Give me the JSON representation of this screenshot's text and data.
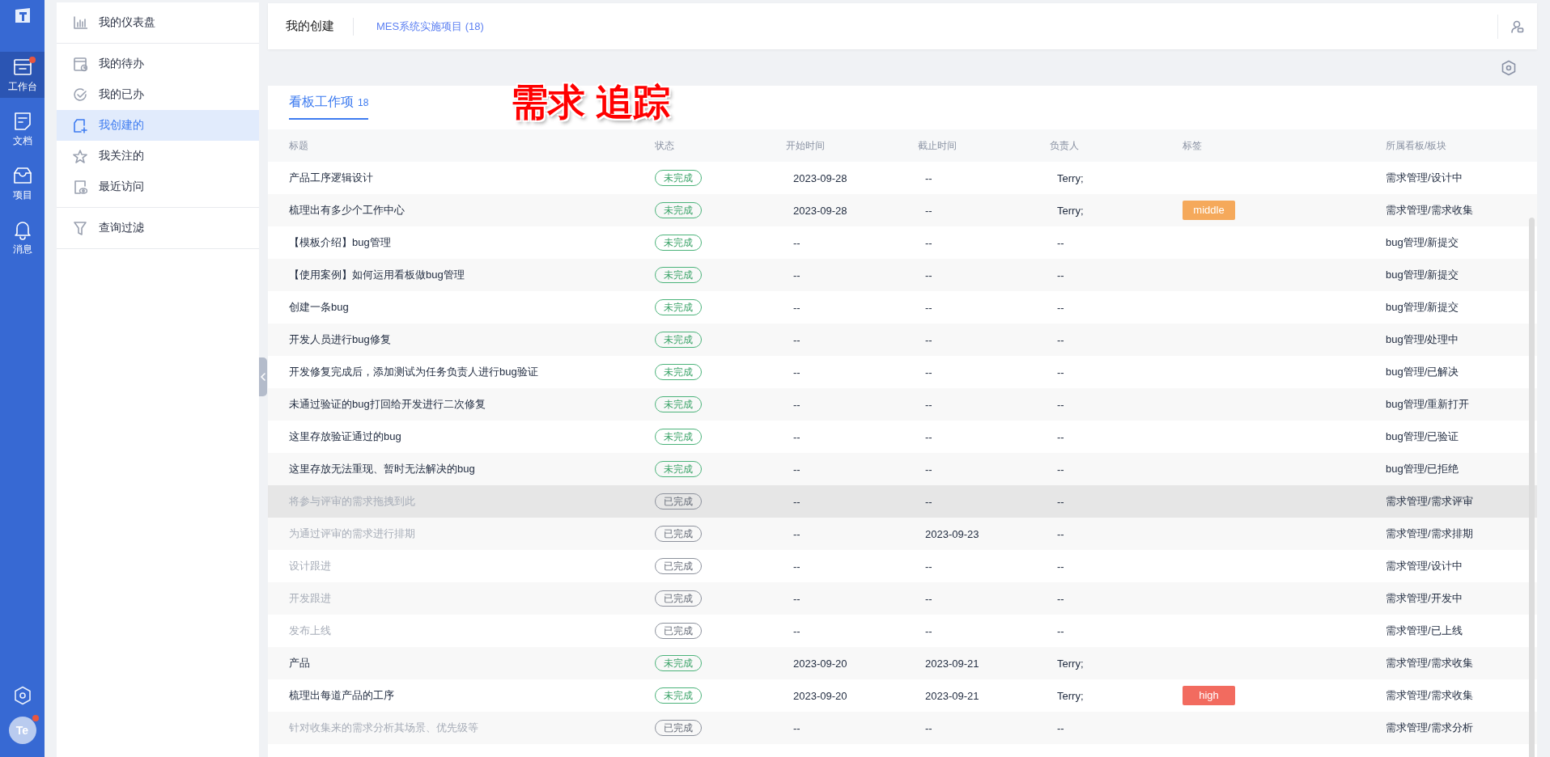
{
  "nav": {
    "items": [
      {
        "label": "工作台",
        "kind": "workbench",
        "selected": true,
        "badge": true
      },
      {
        "label": "文档",
        "kind": "docs",
        "selected": false,
        "badge": false
      },
      {
        "label": "项目",
        "kind": "project",
        "selected": false,
        "badge": false
      },
      {
        "label": "消息",
        "kind": "messages",
        "selected": false,
        "badge": false
      }
    ],
    "avatar": {
      "initials": "Te",
      "badge": true
    }
  },
  "menu": {
    "groups": [
      [
        {
          "label": "我的仪表盘",
          "kind": "dashboard",
          "selected": false
        }
      ],
      [
        {
          "label": "我的待办",
          "kind": "todo",
          "selected": false
        },
        {
          "label": "我的已办",
          "kind": "done",
          "selected": false
        },
        {
          "label": "我创建的",
          "kind": "created",
          "selected": true
        },
        {
          "label": "我关注的",
          "kind": "starred",
          "selected": false
        },
        {
          "label": "最近访问",
          "kind": "recent",
          "selected": false
        }
      ],
      [
        {
          "label": "查询过滤",
          "kind": "filter",
          "selected": false
        }
      ]
    ]
  },
  "header": {
    "title": "我的创建",
    "project": "MES系统实施项目",
    "count": "(18)"
  },
  "board": {
    "tab": {
      "label": "看板工作项",
      "count": "18",
      "selected": true
    },
    "annotation": "需求 追踪",
    "columns": [
      "标题",
      "状态",
      "开始时间",
      "截止时间",
      "负责人",
      "标签",
      "所属看板/板块"
    ],
    "rows": [
      {
        "title": "产品工序逻辑设计",
        "status": {
          "label": "未完成",
          "done": false
        },
        "start": "2023-09-28",
        "end": "--",
        "owner": "Terry;",
        "board": "需求管理/设计中",
        "hovered": false
      },
      {
        "title": "梳理出有多少个工作中心",
        "status": {
          "label": "未完成",
          "done": false
        },
        "start": "2023-09-28",
        "end": "--",
        "owner": "Terry;",
        "tag": {
          "label": "middle",
          "color": "#f5a95b"
        },
        "board": "需求管理/需求收集",
        "hovered": false
      },
      {
        "title": "【模板介绍】bug管理",
        "status": {
          "label": "未完成",
          "done": false
        },
        "start": "--",
        "end": "--",
        "owner": "--",
        "board": "bug管理/新提交",
        "hovered": false
      },
      {
        "title": "【使用案例】如何运用看板做bug管理",
        "status": {
          "label": "未完成",
          "done": false
        },
        "start": "--",
        "end": "--",
        "owner": "--",
        "board": "bug管理/新提交",
        "hovered": false
      },
      {
        "title": "创建一条bug",
        "status": {
          "label": "未完成",
          "done": false
        },
        "start": "--",
        "end": "--",
        "owner": "--",
        "board": "bug管理/新提交",
        "hovered": false
      },
      {
        "title": "开发人员进行bug修复",
        "status": {
          "label": "未完成",
          "done": false
        },
        "start": "--",
        "end": "--",
        "owner": "--",
        "board": "bug管理/处理中",
        "hovered": false
      },
      {
        "title": "开发修复完成后，添加测试为任务负责人进行bug验证",
        "status": {
          "label": "未完成",
          "done": false
        },
        "start": "--",
        "end": "--",
        "owner": "--",
        "board": "bug管理/已解决",
        "hovered": false
      },
      {
        "title": "未通过验证的bug打回给开发进行二次修复",
        "status": {
          "label": "未完成",
          "done": false
        },
        "start": "--",
        "end": "--",
        "owner": "--",
        "board": "bug管理/重新打开",
        "hovered": false
      },
      {
        "title": "这里存放验证通过的bug",
        "status": {
          "label": "未完成",
          "done": false
        },
        "start": "--",
        "end": "--",
        "owner": "--",
        "board": "bug管理/已验证",
        "hovered": false
      },
      {
        "title": "这里存放无法重现、暂时无法解决的bug",
        "status": {
          "label": "未完成",
          "done": false
        },
        "start": "--",
        "end": "--",
        "owner": "--",
        "board": "bug管理/已拒绝",
        "hovered": false
      },
      {
        "title": "将参与评审的需求拖拽到此",
        "status": {
          "label": "已完成",
          "done": true
        },
        "start": "--",
        "end": "--",
        "owner": "--",
        "board": "需求管理/需求评审",
        "hovered": true
      },
      {
        "title": "为通过评审的需求进行排期",
        "status": {
          "label": "已完成",
          "done": true
        },
        "start": "--",
        "end": "2023-09-23",
        "owner": "--",
        "board": "需求管理/需求排期",
        "hovered": false
      },
      {
        "title": "设计跟进",
        "status": {
          "label": "已完成",
          "done": true
        },
        "start": "--",
        "end": "--",
        "owner": "--",
        "board": "需求管理/设计中",
        "hovered": false
      },
      {
        "title": "开发跟进",
        "status": {
          "label": "已完成",
          "done": true
        },
        "start": "--",
        "end": "--",
        "owner": "--",
        "board": "需求管理/开发中",
        "hovered": false
      },
      {
        "title": "发布上线",
        "status": {
          "label": "已完成",
          "done": true
        },
        "start": "--",
        "end": "--",
        "owner": "--",
        "board": "需求管理/已上线",
        "hovered": false
      },
      {
        "title": "产品",
        "status": {
          "label": "未完成",
          "done": false
        },
        "start": "2023-09-20",
        "end": "2023-09-21",
        "owner": "Terry;",
        "board": "需求管理/需求收集",
        "hovered": false
      },
      {
        "title": "梳理出每道产品的工序",
        "status": {
          "label": "未完成",
          "done": false
        },
        "start": "2023-09-20",
        "end": "2023-09-21",
        "owner": "Terry;",
        "tag": {
          "label": "high",
          "color": "#f26b5f"
        },
        "board": "需求管理/需求收集",
        "hovered": false
      },
      {
        "title": "针对收集来的需求分析其场景、优先级等",
        "status": {
          "label": "已完成",
          "done": true
        },
        "start": "--",
        "end": "--",
        "owner": "--",
        "board": "需求管理/需求分析",
        "hovered": false
      }
    ]
  }
}
